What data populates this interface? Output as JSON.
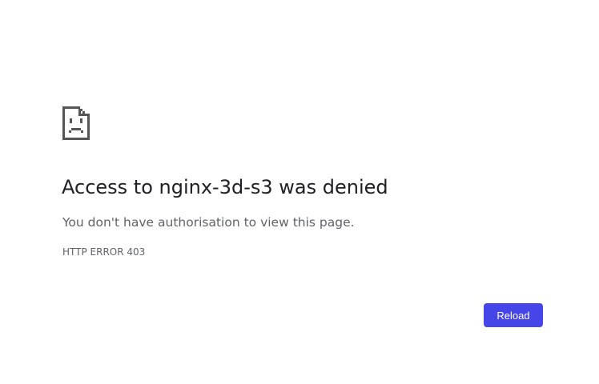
{
  "icon": "sad-document-icon",
  "title": "Access to nginx-3d-s3 was denied",
  "message": "You don't have authorisation to view this page.",
  "error_code": "HTTP ERROR 403",
  "reload_label": "Reload",
  "colors": {
    "accent": "#4646e8",
    "title": "#202124",
    "text": "#5f6368",
    "icon": "#555555"
  }
}
